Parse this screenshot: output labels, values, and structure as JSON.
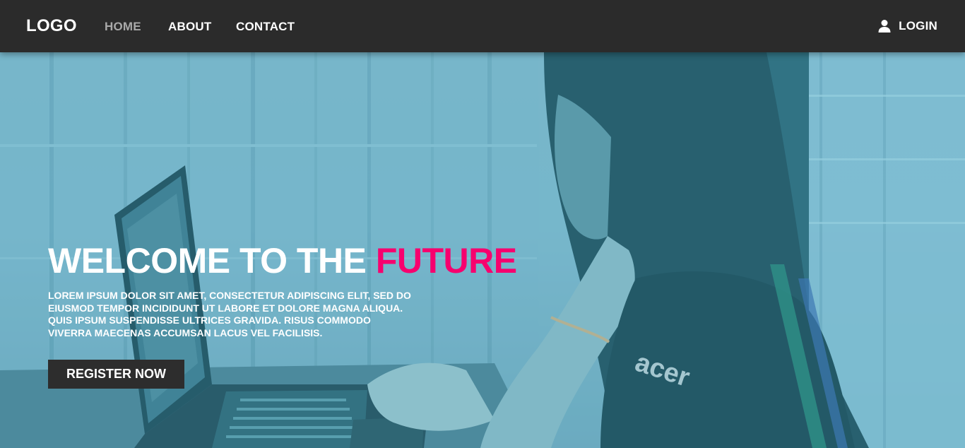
{
  "nav": {
    "logo": "LOGO",
    "links": [
      "HOME",
      "ABOUT",
      "CONTACT"
    ],
    "active": "HOME",
    "login_label": "LOGIN",
    "login_icon": "user-icon"
  },
  "hero": {
    "title_prefix": "WELCOME TO THE",
    "title_accent": "FUTURE",
    "description": "LOREM IPSUM DOLOR SIT AMET, CONSECTETUR ADIPISCING ELIT, SED DO EIUSMOD TEMPOR INCIDIDUNT UT LABORE ET DOLORE MAGNA ALIQUA. QUIS IPSUM SUSPENDISSE ULTRICES GRAVIDA. RISUS COMMODO VIVERRA MAECENAS ACCUMSAN LACUS VEL FACILISIS.",
    "register_label": "REGISTER NOW",
    "laptop_brand": "acer"
  },
  "colors": {
    "navbar": "#2b2b2b",
    "accent": "#f7006e",
    "nav_active": "#a9a9a9",
    "button": "#2d2d2d",
    "hero_tint": "#7ab8cd"
  }
}
